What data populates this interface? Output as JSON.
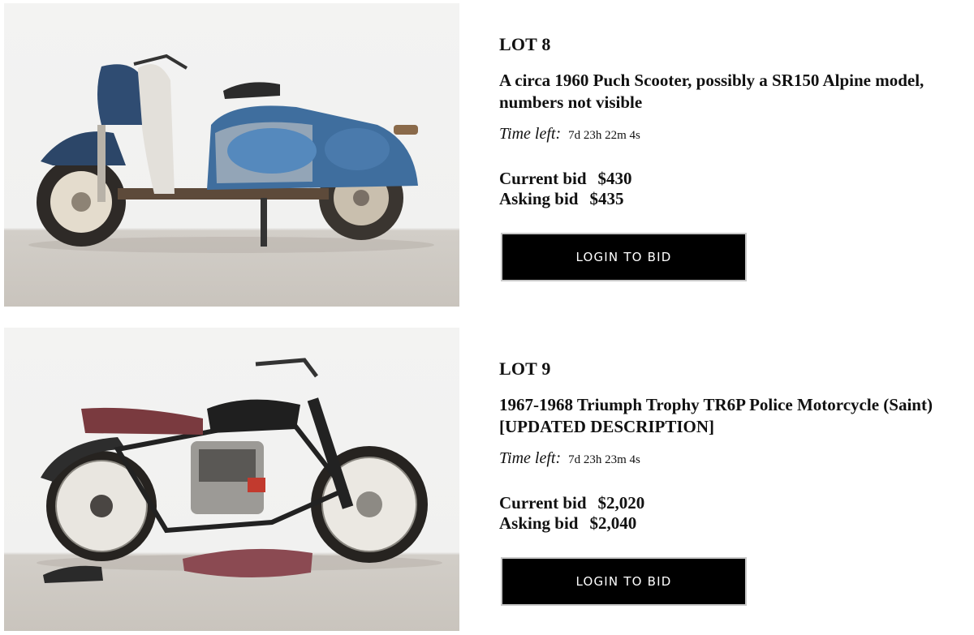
{
  "lots": [
    {
      "lot_label": "LOT 8",
      "title": "A circa 1960 Puch Scooter, possibly a SR150 Alpine model, numbers not visible",
      "time_left_label": "Time left:",
      "time_left_value": "7d 23h 22m 4s",
      "current_bid_label": "Current bid",
      "current_bid_value": "$430",
      "asking_bid_label": "Asking bid",
      "asking_bid_value": "$435",
      "button_label": "LOGIN TO BID",
      "image_subject": "blue weathered scooter photo"
    },
    {
      "lot_label": "LOT 9",
      "title": "1967-1968 Triumph Trophy TR6P Police Motorcycle (Saint) [UPDATED DESCRIPTION]",
      "time_left_label": "Time left:",
      "time_left_value": "7d 23h 23m 4s",
      "current_bid_label": "Current bid",
      "current_bid_value": "$2,020",
      "asking_bid_label": "Asking bid",
      "asking_bid_value": "$2,040",
      "button_label": "LOGIN TO BID",
      "image_subject": "black vintage motorcycle photo"
    }
  ],
  "colors": {
    "button_bg": "#000000",
    "button_text": "#ffffff",
    "scooter_blue": "#3f6e9e",
    "seat_maroon": "#7a3a3f"
  }
}
